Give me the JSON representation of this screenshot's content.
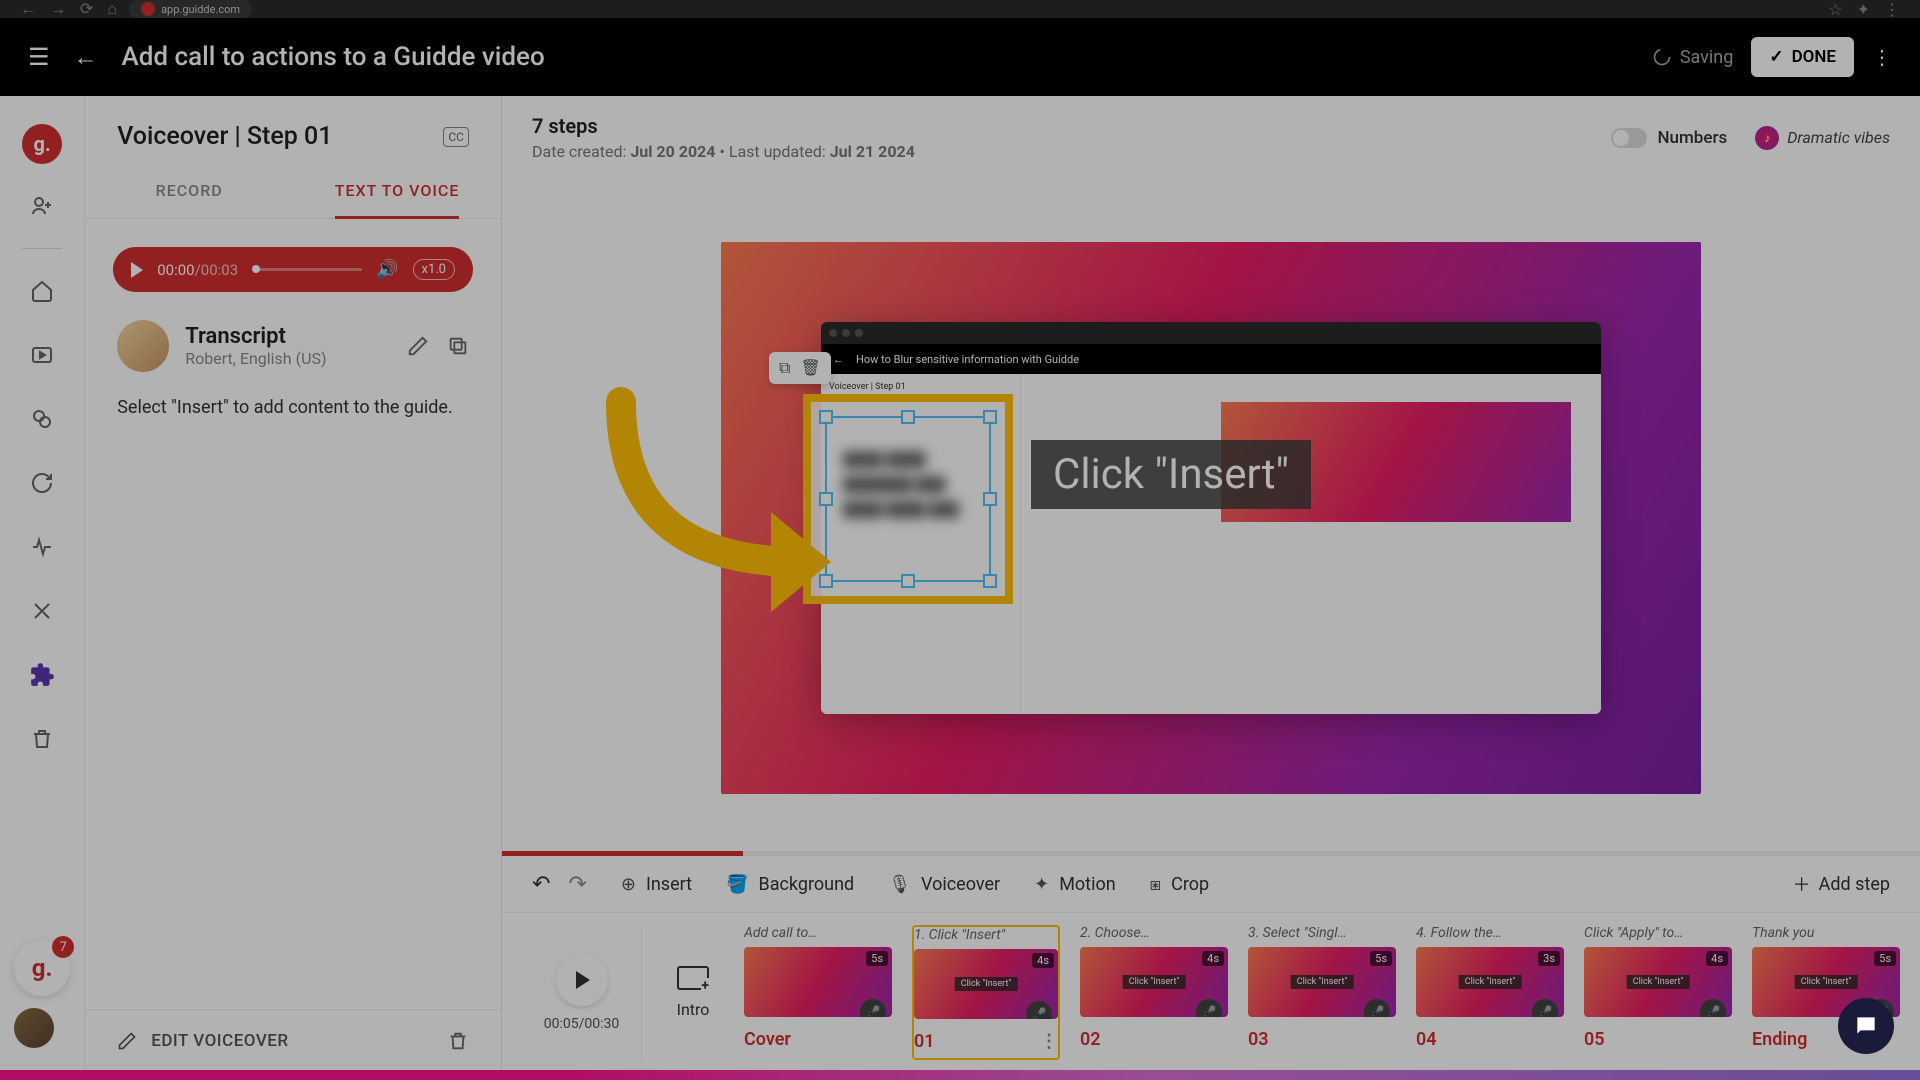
{
  "browser": {
    "url": "app.guidde.com"
  },
  "header": {
    "title": "Add call to actions to a Guidde video",
    "saving": "Saving",
    "done": "DONE"
  },
  "leftPanel": {
    "title": "Voiceover | Step 01",
    "tabs": {
      "record": "RECORD",
      "tts": "TEXT TO VOICE"
    },
    "player": {
      "current": "00:00",
      "total": "/00:03",
      "speed": "x1.0"
    },
    "transcript": {
      "heading": "Transcript",
      "speaker": "Robert, English (US)",
      "body": "Select \"Insert\" to add content to the guide."
    },
    "footer": {
      "edit": "EDIT VOICEOVER"
    }
  },
  "meta": {
    "steps": "7 steps",
    "createdLabel": "Date created: ",
    "created": "Jul 20 2024",
    "sep": " • Last updated: ",
    "updated": "Jul 21 2024",
    "numbers": "Numbers",
    "vibes": "Dramatic vibes"
  },
  "canvas": {
    "clickLabel": "Click \"Insert\"",
    "innerTitle": "How to Blur sensitive information with Guidde"
  },
  "toolbar": {
    "insert": "Insert",
    "background": "Background",
    "voiceover": "Voiceover",
    "motion": "Motion",
    "crop": "Crop",
    "addStep": "Add step"
  },
  "timeline": {
    "playTime": "00:05/00:30",
    "intro": "Intro",
    "steps": [
      {
        "caption": "Add call to…",
        "duration": "5s",
        "label": "Cover",
        "cover": true
      },
      {
        "caption": "1. Click \"Insert\"",
        "duration": "4s",
        "label": "01",
        "selected": true
      },
      {
        "caption": "2. Choose…",
        "duration": "4s",
        "label": "02"
      },
      {
        "caption": "3. Select \"Singl…",
        "duration": "5s",
        "label": "03"
      },
      {
        "caption": "4. Follow the…",
        "duration": "3s",
        "label": "04"
      },
      {
        "caption": "Click \"Apply\" to…",
        "duration": "4s",
        "label": "05"
      },
      {
        "caption": "Thank you",
        "duration": "5s",
        "label": "Ending"
      }
    ]
  },
  "badge": {
    "count": "7"
  }
}
